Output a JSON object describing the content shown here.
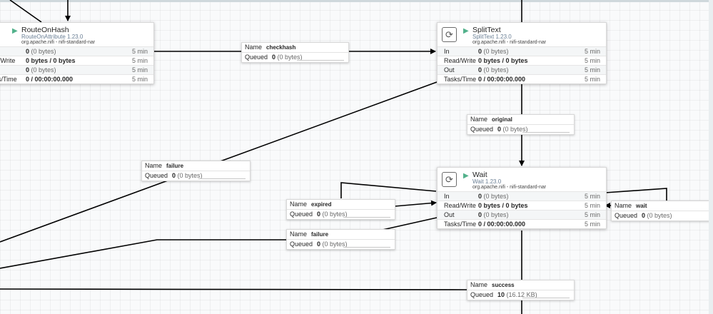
{
  "processors": [
    {
      "id": "routeonhash",
      "name": "RouteOnHash",
      "type": "RouteOnAttribute 1.23.0",
      "bundle": "org.apache.nifi - nifi-standard-nar",
      "stats": [
        {
          "label": "",
          "value_bold": "0",
          "value_rest": " (0 bytes)",
          "time": "5 min"
        },
        {
          "label": "ead/Write",
          "value_bold": "0 bytes / 0 bytes",
          "value_rest": "",
          "time": "5 min"
        },
        {
          "label": "",
          "value_bold": "0",
          "value_rest": " (0 bytes)",
          "time": "5 min"
        },
        {
          "label": "asks/Time",
          "value_bold": "0 / 00:00:00.000",
          "value_rest": "",
          "time": "5 min"
        }
      ]
    },
    {
      "id": "splittext",
      "name": "SplitText",
      "type": "SplitText 1.23.0",
      "bundle": "org.apache.nifi - nifi-standard-nar",
      "stats": [
        {
          "label": "In",
          "value_bold": "0",
          "value_rest": " (0 bytes)",
          "time": "5 min"
        },
        {
          "label": "Read/Write",
          "value_bold": "0 bytes / 0 bytes",
          "value_rest": "",
          "time": "5 min"
        },
        {
          "label": "Out",
          "value_bold": "0",
          "value_rest": " (0 bytes)",
          "time": "5 min"
        },
        {
          "label": "Tasks/Time",
          "value_bold": "0 / 00:00:00.000",
          "value_rest": "",
          "time": "5 min"
        }
      ]
    },
    {
      "id": "wait",
      "name": "Wait",
      "type": "Wait 1.23.0",
      "bundle": "org.apache.nifi - nifi-standard-nar",
      "stats": [
        {
          "label": "In",
          "value_bold": "0",
          "value_rest": " (0 bytes)",
          "time": "5 min"
        },
        {
          "label": "Read/Write",
          "value_bold": "0 bytes / 0 bytes",
          "value_rest": "",
          "time": "5 min"
        },
        {
          "label": "Out",
          "value_bold": "0",
          "value_rest": " (0 bytes)",
          "time": "5 min"
        },
        {
          "label": "Tasks/Time",
          "value_bold": "0 / 00:00:00.000",
          "value_rest": "",
          "time": "5 min"
        }
      ]
    }
  ],
  "connections": [
    {
      "id": "checkhash",
      "name_label": "Name",
      "name": "checkhash",
      "queued_label": "Queued",
      "count": "0",
      "size": " (0 bytes)"
    },
    {
      "id": "original",
      "name_label": "Name",
      "name": "original",
      "queued_label": "Queued",
      "count": "0",
      "size": " (0 bytes)"
    },
    {
      "id": "failure-1",
      "name_label": "Name",
      "name": "failure",
      "queued_label": "Queued",
      "count": "0",
      "size": " (0 bytes)"
    },
    {
      "id": "expired",
      "name_label": "Name",
      "name": "expired",
      "queued_label": "Queued",
      "count": "0",
      "size": " (0 bytes)"
    },
    {
      "id": "failure-2",
      "name_label": "Name",
      "name": "failure",
      "queued_label": "Queued",
      "count": "0",
      "size": " (0 bytes)"
    },
    {
      "id": "wait",
      "name_label": "Name",
      "name": "wait",
      "queued_label": "Queued",
      "count": "0",
      "size": " (0 bytes)"
    },
    {
      "id": "success",
      "name_label": "Name",
      "name": "success",
      "queued_label": "Queued",
      "count": "10",
      "size": " (16.12 KB)"
    }
  ],
  "icons": {
    "processor": "refresh-icon",
    "run_state": "play-icon"
  },
  "colors": {
    "canvas": "#f9fafb",
    "grid": "#e6e8ea",
    "run_state": "#52b18b",
    "type_text": "#6a7f95",
    "wire": "#000000"
  }
}
